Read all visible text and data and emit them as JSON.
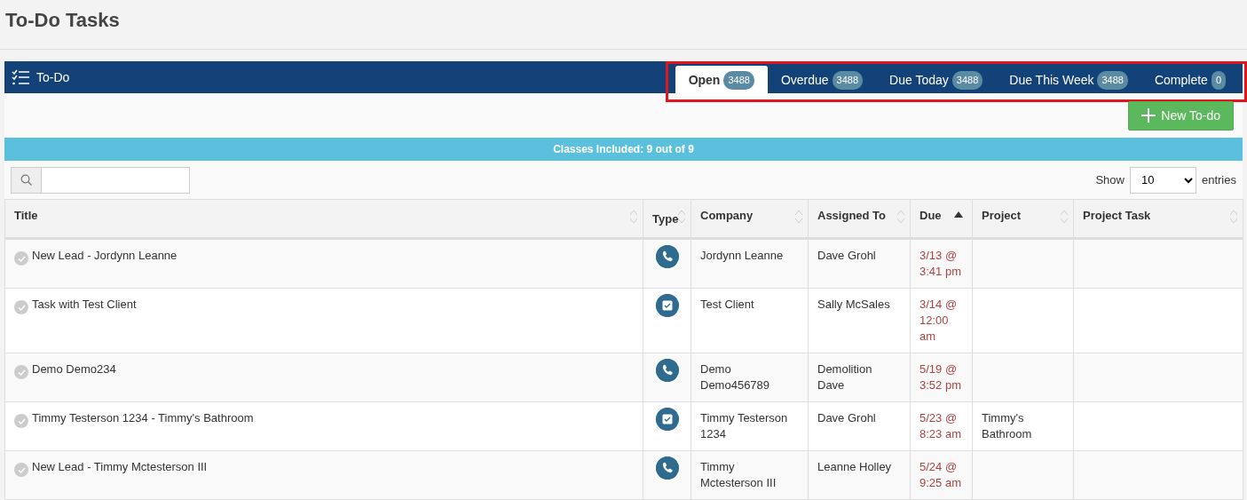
{
  "page_title": "To-Do Tasks",
  "panel": {
    "title": "To-Do",
    "tabs_highlighted": true
  },
  "tabs": [
    {
      "label": "Open",
      "count": "3488",
      "selected": true
    },
    {
      "label": "Overdue",
      "count": "3488",
      "selected": false
    },
    {
      "label": "Due Today",
      "count": "3488",
      "selected": false
    },
    {
      "label": "Due This Week",
      "count": "3488",
      "selected": false
    },
    {
      "label": "Complete",
      "count": "0",
      "selected": false
    }
  ],
  "new_button": "New To-do",
  "info_bar": "Classes Included: 9 out of 9",
  "length": {
    "before": "Show",
    "value": "10",
    "after": "entries"
  },
  "table": {
    "columns": [
      {
        "label": "Title",
        "sorted": false
      },
      {
        "label": "Type",
        "sorted": false
      },
      {
        "label": "Company",
        "sorted": false
      },
      {
        "label": "Assigned To",
        "sorted": false
      },
      {
        "label": "Due",
        "sorted": true
      },
      {
        "label": "Project",
        "sorted": false
      },
      {
        "label": "Project Task",
        "sorted": false
      }
    ],
    "rows": [
      {
        "title": "New Lead - Jordynn Leanne",
        "kind": "call",
        "company": "Jordynn Leanne",
        "assigned_to": "Dave Grohl",
        "due": "3/13 @ 3:41 pm"
      },
      {
        "title": "Task with Test Client",
        "kind": "task",
        "company": "Test Client",
        "assigned_to": "Sally McSales",
        "due": "3/14 @ 12:00 am"
      },
      {
        "title": "Demo Demo234",
        "kind": "call",
        "company": "Demo Demo456789",
        "assigned_to": "Demolition Dave",
        "due": "5/19 @ 3:52 pm"
      },
      {
        "title": "Timmy Testerson 1234 - Timmy's Bathroom",
        "kind": "task",
        "company": "Timmy Testerson 1234",
        "assigned_to": "Dave Grohl",
        "due": "5/23 @ 8:23 am",
        "project": "Timmy's Bathroom"
      },
      {
        "title": "New Lead - Timmy Mctesterson III",
        "kind": "call",
        "company": "Timmy Mctesterson III",
        "assigned_to": "Leanne Holley",
        "due": "5/24 @ 9:25 am"
      }
    ]
  }
}
